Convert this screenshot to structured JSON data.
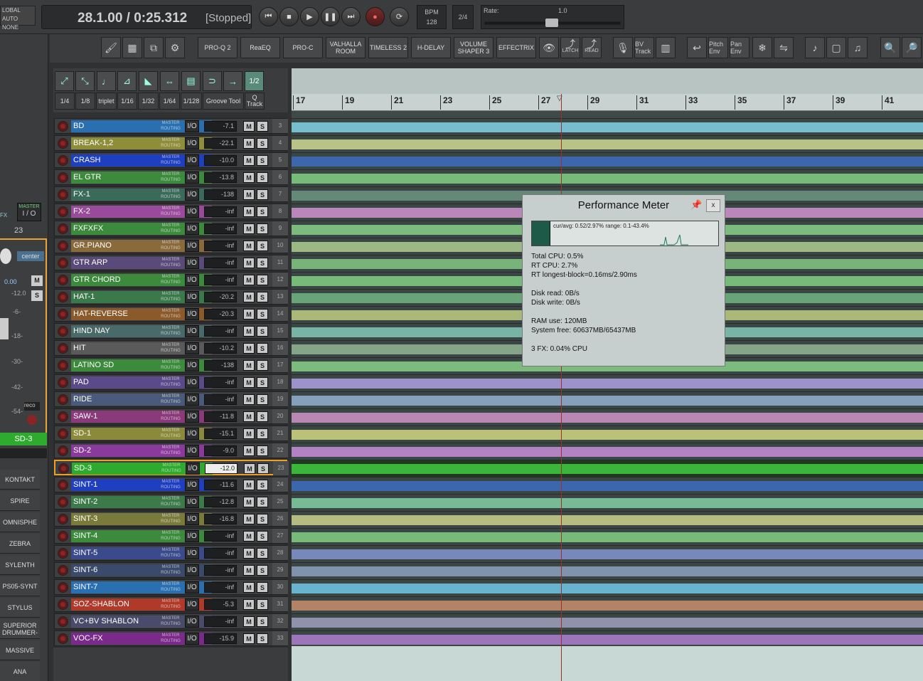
{
  "transport": {
    "global_auto": "LOBAL AUTO",
    "global_auto_mode": "NONE",
    "position": "28.1.00 / 0:25.312",
    "state": "[Stopped]",
    "bpm_label": "BPM",
    "bpm": "128",
    "time_sig": "2/4",
    "rate_label": "Rate:",
    "rate": "1.0"
  },
  "fx_buttons": [
    "PRO-Q 2",
    "ReaEQ",
    "PRO-C",
    "VALHALLA ROOM",
    "TIMELESS 2",
    "H-DELAY",
    "VOLUME SHAPER 3",
    "EFFECTRIX"
  ],
  "toolbar_small": {
    "latch": "LATCH",
    "read": "READ",
    "bv": "BV Track",
    "pitch": "Pitch Env",
    "pan": "Pan Env"
  },
  "grid": {
    "labels": [
      "1/4",
      "1/8",
      "triplet",
      "1/16",
      "1/32",
      "1/64",
      "1/128",
      "Groove Tool",
      "Q Track"
    ],
    "half": "1/2"
  },
  "mixer_strip": {
    "master_label": "MASTER",
    "io_label": "I / O",
    "track_num": "23",
    "pan": "center",
    "vol": "0.00",
    "scale": [
      "-12.0",
      "-6-",
      "-18-",
      "-30-",
      "-42-",
      "-54-"
    ],
    "m": "M",
    "s": "S",
    "fx": "FX",
    "rec": "reco",
    "name": "SD-3"
  },
  "vsti": [
    "KONTAKT",
    "SPIRE",
    "OMNISPHE",
    "ZEBRA",
    "SYLENTH",
    "PS05-SYNT",
    "STYLUS",
    "SUPERIOR DRUMMER-",
    "MASSIVE",
    "ANA"
  ],
  "ruler": [
    "17",
    "19",
    "21",
    "23",
    "25",
    "27",
    "29",
    "31",
    "33",
    "35",
    "37",
    "39",
    "41"
  ],
  "track_common": {
    "master": "MASTER",
    "route": "ROUTING",
    "io": "I/O",
    "m": "M",
    "s": "S"
  },
  "tracks": [
    {
      "name": "BD",
      "color": "#2a6fb0",
      "vol": "-7.1",
      "num": "3",
      "lane": "#7ec9df"
    },
    {
      "name": "BREAK-1,2",
      "color": "#8d8d3a",
      "vol": "-22.1",
      "num": "4",
      "lane": "#c9d08f"
    },
    {
      "name": "CRASH",
      "color": "#1e3fbf",
      "vol": "-10.0",
      "num": "5",
      "lane": "#3e6ab8"
    },
    {
      "name": "EL GTR",
      "color": "#3c8a3c",
      "vol": "-13.8",
      "num": "6",
      "lane": "#7fc77f"
    },
    {
      "name": "FX-1",
      "color": "#3a6b5a",
      "vol": "-138",
      "num": "7",
      "lane": "#6b8f80"
    },
    {
      "name": "FX-2",
      "color": "#9a4a9a",
      "vol": "-inf",
      "num": "8",
      "lane": "#c88ec8"
    },
    {
      "name": "FXFXFX",
      "color": "#3c8a3c",
      "vol": "-inf",
      "num": "9",
      "lane": "#84c884"
    },
    {
      "name": "GR.PIANO",
      "color": "#8a6a3a",
      "vol": "-inf",
      "num": "10",
      "lane": "#a7c48c"
    },
    {
      "name": "GTR ARP",
      "color": "#5a4a7a",
      "vol": "-inf",
      "num": "11",
      "lane": "#7fbf7f"
    },
    {
      "name": "GTR CHORD",
      "color": "#3c8a3c",
      "vol": "-inf",
      "num": "12",
      "lane": "#7fc77f"
    },
    {
      "name": "HAT-1",
      "color": "#3a7a4a",
      "vol": "-20.2",
      "num": "13",
      "lane": "#6fae7f"
    },
    {
      "name": "HAT-REVERSE",
      "color": "#8a5a2a",
      "vol": "-20.3",
      "num": "14",
      "lane": "#b8c47f"
    },
    {
      "name": "HIND NAY",
      "color": "#4a6a6a",
      "vol": "-inf",
      "num": "15",
      "lane": "#7fbfae"
    },
    {
      "name": "HIT",
      "color": "#5a5a5a",
      "vol": "-10.2",
      "num": "16",
      "lane": "#8fae8f"
    },
    {
      "name": "LATINO SD",
      "color": "#3c8a3c",
      "vol": "-138",
      "num": "17",
      "lane": "#84c884"
    },
    {
      "name": "PAD",
      "color": "#5a4a8a",
      "vol": "-inf",
      "num": "18",
      "lane": "#a99ad8"
    },
    {
      "name": "RIDE",
      "color": "#4a5a7a",
      "vol": "-inf",
      "num": "19",
      "lane": "#8fa8c8"
    },
    {
      "name": "SAW-1",
      "color": "#8a3a7a",
      "vol": "-11.8",
      "num": "20",
      "lane": "#c88ec0"
    },
    {
      "name": "SD-1",
      "color": "#8a8a3a",
      "vol": "-15.1",
      "num": "21",
      "lane": "#c9cf7f"
    },
    {
      "name": "SD-2",
      "color": "#8a3a9a",
      "vol": "-9.0",
      "num": "22",
      "lane": "#c08ad0"
    },
    {
      "name": "SD-3",
      "color": "#2eaa2e",
      "vol": "-12.0",
      "num": "23",
      "lane": "#3ec43e",
      "selected": true
    },
    {
      "name": "SINT-1",
      "color": "#1e3fbf",
      "vol": "-11.6",
      "num": "24",
      "lane": "#3e6ab8"
    },
    {
      "name": "SINT-2",
      "color": "#3c7a4a",
      "vol": "-12.8",
      "num": "25",
      "lane": "#7fc7a0"
    },
    {
      "name": "SINT-3",
      "color": "#7a7a3a",
      "vol": "-16.8",
      "num": "26",
      "lane": "#c4c88a"
    },
    {
      "name": "SINT-4",
      "color": "#3c8a3c",
      "vol": "-inf",
      "num": "27",
      "lane": "#7fc77f"
    },
    {
      "name": "SINT-5",
      "color": "#3a4a8a",
      "vol": "-inf",
      "num": "28",
      "lane": "#7f8fc8"
    },
    {
      "name": "SINT-6",
      "color": "#3a4a6a",
      "vol": "-inf",
      "num": "29",
      "lane": "#8a9ab8"
    },
    {
      "name": "SINT-7",
      "color": "#2a6fb0",
      "vol": "-inf",
      "num": "30",
      "lane": "#6fbfdf"
    },
    {
      "name": "SOZ-SHABLON",
      "color": "#b03a2a",
      "vol": "-5.3",
      "num": "31",
      "lane": "#c08a6a"
    },
    {
      "name": "VC+BV SHABLON",
      "color": "#4a4a6a",
      "vol": "-inf",
      "num": "32",
      "lane": "#9a9ab8"
    },
    {
      "name": "VOC-FX",
      "color": "#7a2a8a",
      "vol": "-15.9",
      "num": "33",
      "lane": "#a87ac8"
    }
  ],
  "perf_meter": {
    "title": "Performance Meter",
    "close": "x",
    "graph_text": "cur/avg: 0.52/2.97%   range: 0.1-43.4%",
    "lines": [
      "Total CPU: 0.5%",
      "RT CPU: 2.7%",
      "RT longest-block=0.16ms/2.90ms",
      "",
      "Disk read: 0B/s",
      "Disk write: 0B/s",
      "",
      "RAM use: 120MB",
      "System free: 60637MB/65437MB",
      "",
      "3 FX: 0.04% CPU"
    ]
  }
}
